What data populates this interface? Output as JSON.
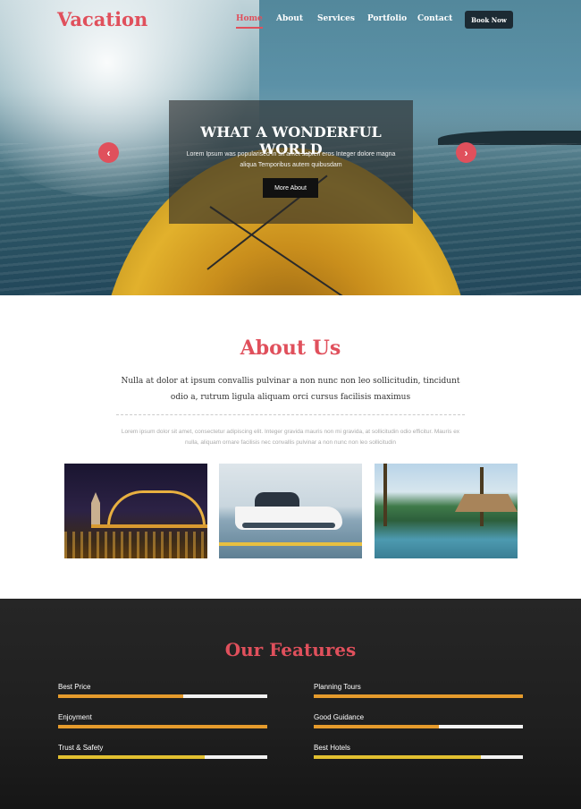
{
  "site": {
    "logo": "Vacation",
    "nav": [
      "Home",
      "About",
      "Services",
      "Portfolio",
      "Contact"
    ],
    "active_nav": "Home",
    "book_button": "Book Now"
  },
  "hero": {
    "title": "WHAT A WONDERFUL WORLD",
    "text": "Lorem Ipsum was popularised in sit amet sapien eros Integer dolore magna aliqua Temporibus autem quibusdam",
    "button": "More About",
    "prev_icon": "chevron-left-icon",
    "next_icon": "chevron-right-icon",
    "prev_glyph": "‹",
    "next_glyph": "›"
  },
  "about": {
    "title": "About Us",
    "lead": "Nulla at dolor at ipsum convallis pulvinar a non nunc non leo sollicitudin, tincidunt odio a, rutrum ligula aliquam orci cursus facilisis maximus",
    "text": "Lorem ipsum dolor sit amet, consectetur adipiscing elit. Integer gravida mauris non mi gravida, at sollicitudin odio efficitur. Mauris ex nulla, aliquam ornare facilisis nec convallis pulvinar a non nunc non leo sollicitudin"
  },
  "features": {
    "title": "Our Features",
    "items": [
      {
        "label": "Best Price",
        "level": 0.6
      },
      {
        "label": "Planning Tours",
        "level": 1.0
      },
      {
        "label": "Enjoyment",
        "level": 1.0
      },
      {
        "label": "Good Guidance",
        "level": 0.6
      },
      {
        "label": "Trust & Safety",
        "level": 0.7
      },
      {
        "label": "Best Hotels",
        "level": 0.8
      }
    ]
  },
  "colors": {
    "accent": "#e0505c",
    "progress": "#e59b2c",
    "button_dark": "#1c2a33",
    "features_bg": "#222222"
  }
}
